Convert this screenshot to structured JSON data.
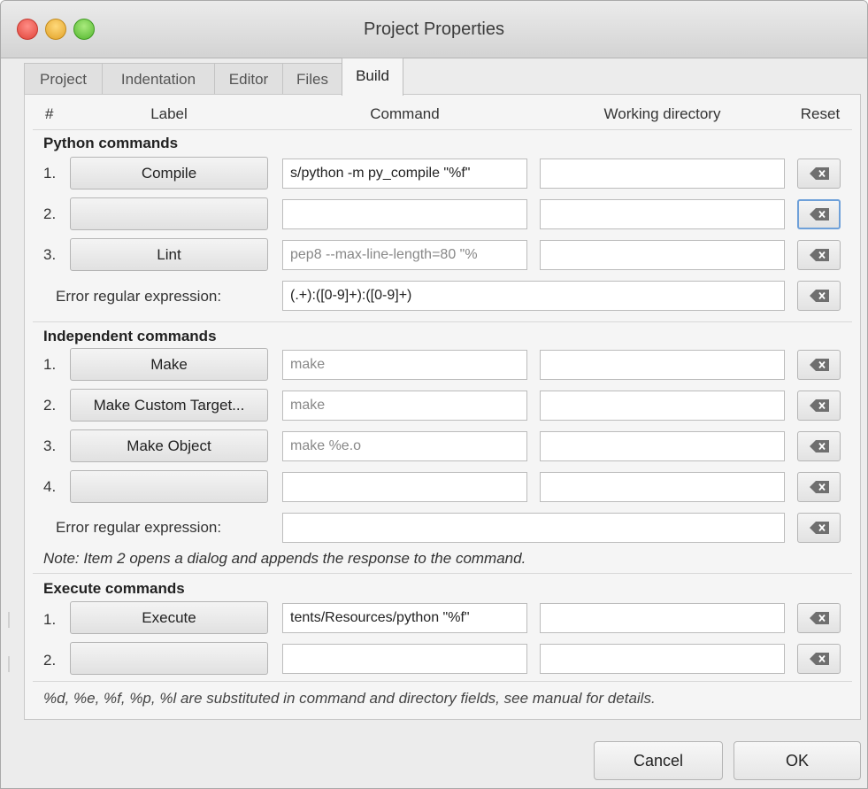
{
  "window": {
    "title": "Project Properties"
  },
  "tabs": [
    {
      "label": "Project",
      "active": false
    },
    {
      "label": "Indentation",
      "active": false
    },
    {
      "label": "Editor",
      "active": false
    },
    {
      "label": "Files",
      "active": false
    },
    {
      "label": "Build",
      "active": true
    }
  ],
  "columns": {
    "num": "#",
    "label": "Label",
    "command": "Command",
    "dir": "Working directory",
    "reset": "Reset"
  },
  "python": {
    "heading": "Python commands",
    "rows": [
      {
        "num": "1.",
        "label": "Compile",
        "command": "s/python -m py_compile \"%f\"",
        "command_placeholder": false,
        "dir": ""
      },
      {
        "num": "2.",
        "label": "",
        "command": "",
        "command_placeholder": false,
        "dir": ""
      },
      {
        "num": "3.",
        "label": "Lint",
        "command": "pep8 --max-line-length=80 \"%",
        "command_placeholder": true,
        "dir": ""
      }
    ],
    "error_label": "Error regular expression:",
    "error_value": "(.+):([0-9]+):([0-9]+)"
  },
  "independent": {
    "heading": "Independent commands",
    "rows": [
      {
        "num": "1.",
        "label": "Make",
        "command": "make",
        "command_placeholder": true,
        "dir": ""
      },
      {
        "num": "2.",
        "label": "Make Custom Target...",
        "command": "make",
        "command_placeholder": true,
        "dir": ""
      },
      {
        "num": "3.",
        "label": "Make Object",
        "command": "make %e.o",
        "command_placeholder": true,
        "dir": ""
      },
      {
        "num": "4.",
        "label": "",
        "command": "",
        "command_placeholder": false,
        "dir": ""
      }
    ],
    "error_label": "Error regular expression:",
    "error_value": "",
    "note": "Note: Item 2 opens a dialog and appends the response to the command."
  },
  "execute": {
    "heading": "Execute commands",
    "rows": [
      {
        "num": "1.",
        "label": "Execute",
        "command": "tents/Resources/python \"%f\"",
        "command_placeholder": false,
        "dir": ""
      },
      {
        "num": "2.",
        "label": "",
        "command": "",
        "command_placeholder": false,
        "dir": ""
      }
    ]
  },
  "footer_note": "%d, %e, %f, %p, %l are substituted in command and directory fields, see manual for details.",
  "buttons": {
    "cancel": "Cancel",
    "ok": "OK"
  },
  "icons": {
    "reset": "clear-backspace-icon"
  },
  "colors": {
    "focus_ring": "#6ea0d9",
    "placeholder_text": "#888888"
  }
}
